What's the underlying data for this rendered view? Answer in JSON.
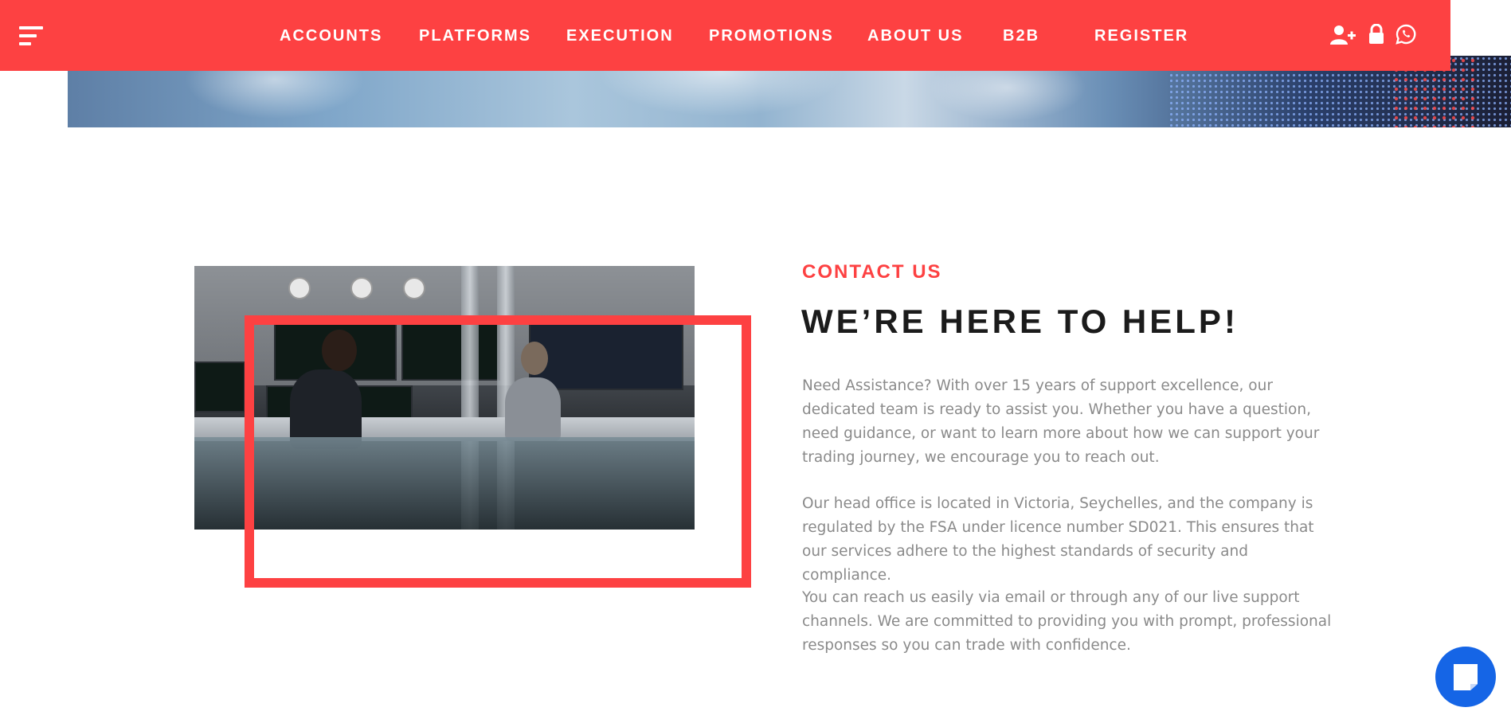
{
  "nav": {
    "menu_icon": "hamburger-menu-icon",
    "items": [
      {
        "label": "ACCOUNTS"
      },
      {
        "label": "PLATFORMS"
      },
      {
        "label": "EXECUTION"
      },
      {
        "label": "PROMOTIONS"
      },
      {
        "label": "ABOUT US"
      },
      {
        "label": "B2B"
      },
      {
        "label": "REGISTER"
      }
    ],
    "icons": [
      "add-user-icon",
      "lock-icon",
      "whatsapp-icon"
    ],
    "background_color": "#fd4142"
  },
  "contact": {
    "eyebrow": "CONTACT US",
    "heading": "WE’RE HERE TO HELP!",
    "paragraphs": [
      "Need Assistance? With over 15 years of support excellence, our dedicated team is ready to assist you. Whether you have a question, need guidance, or want to learn more about how we can support your trading journey, we encourage you to reach out.",
      "Our head office is located in Victoria, Seychelles, and the company is regulated by the FSA under licence number SD021. This ensures that our services adhere to the highest standards of security and compliance.",
      "You can reach us easily via email or through any of our live support channels. We are committed to providing you with prompt, professional responses so you can trade with confidence."
    ],
    "accent_color": "#fd4142"
  },
  "chat": {
    "icon": "chat-bubble-icon",
    "color": "#1565e6"
  }
}
